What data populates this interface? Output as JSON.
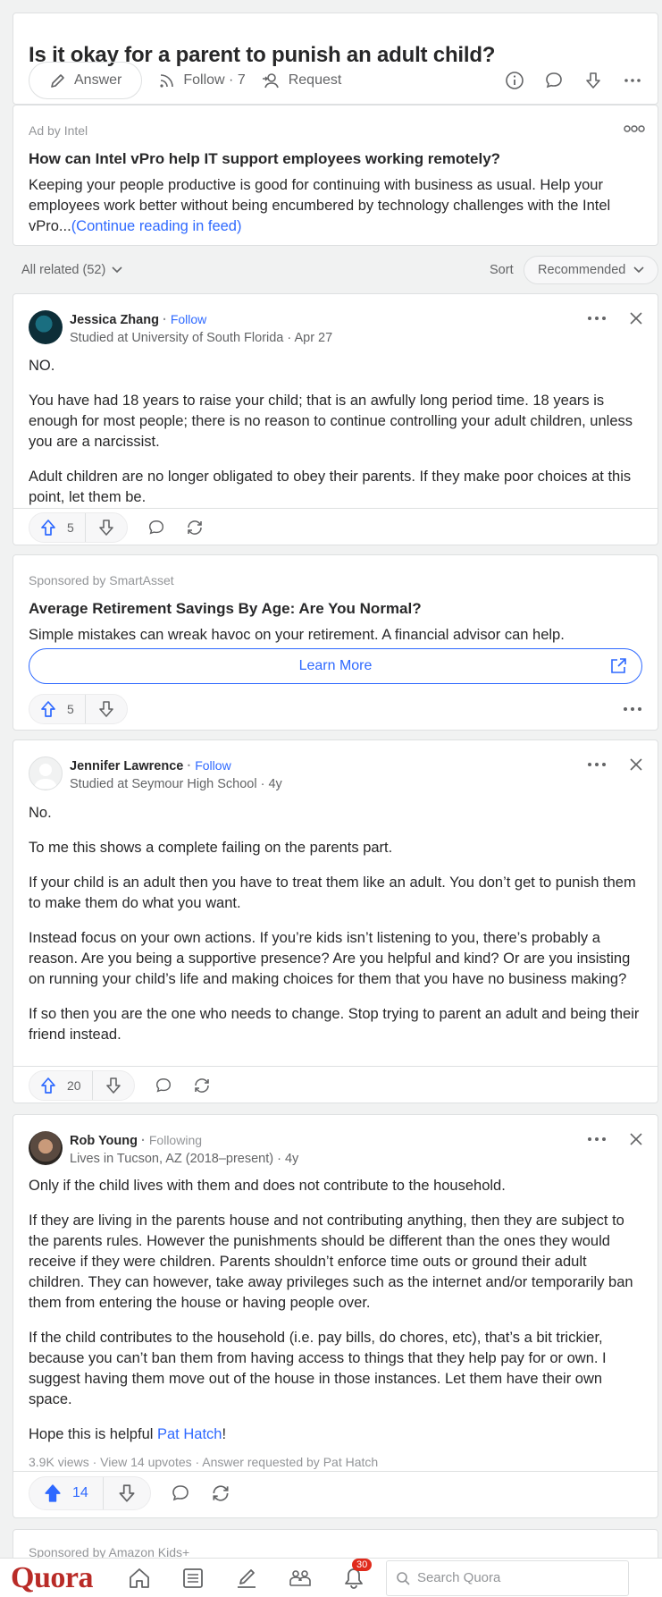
{
  "question": {
    "title": "Is it okay for a parent to punish an adult child?",
    "answer_label": "Answer",
    "follow_label": "Follow · 7",
    "request_label": "Request"
  },
  "ad_intel": {
    "label": "Ad by Intel",
    "headline": "How can Intel vPro help IT support employees working remotely?",
    "body": "Keeping your people productive is good for continuing with business as usual. Help your employees work better without being encumbered by technology challenges with the Intel vPro...",
    "continue_link": "(Continue reading in feed)"
  },
  "related": {
    "all_related": "All related (52)",
    "sort_label": "Sort",
    "sort_value": "Recommended"
  },
  "answers": [
    {
      "author": "Jessica Zhang",
      "follow": "Follow",
      "credential": "Studied at University of South Florida · Apr 27",
      "paragraphs": [
        "NO.",
        "You have had 18 years to raise your child; that is an awfully long period time. 18 years is enough for most people; there is no reason to continue controlling your adult children, unless you are a narcissist.",
        "Adult children are no longer obligated to obey their parents. If they make poor choices at this point, let them be."
      ],
      "upvotes": "5"
    },
    {
      "author": "Jennifer Lawrence",
      "follow": "Follow",
      "credential": "Studied at Seymour High School · 4y",
      "paragraphs": [
        "No.",
        "To me this shows a complete failing on the parents part.",
        "If your child is an adult then you have to treat them like an adult. You don’t get to punish them to make them do what you want.",
        "Instead focus on your own actions. If you’re kids isn’t listening to you, there’s probably a reason. Are you being a supportive presence? Are you helpful and kind? Or are you insisting on running your child’s life and making choices for them that you have no business making?",
        "If so then you are the one who needs to change. Stop trying to parent an adult and being their friend instead."
      ],
      "upvotes": "20"
    },
    {
      "author": "Rob Young",
      "follow": "Following",
      "credential": "Lives in Tucson, AZ (2018–present) · 4y",
      "paragraphs": [
        "Only if the child lives with them and does not contribute to the household.",
        "If they are living in the parents house and not contributing anything, then they are subject to the parents rules. However the punishments should be different than the ones they would receive if they were children. Parents shouldn’t enforce time outs or ground their adult children. They can however, take away privileges such as the internet and/or temporarily ban them from entering the house or having people over.",
        "If the child contributes to the household (i.e. pay bills, do chores, etc), that’s a bit trickier, because you can’t ban them from having access to things that they help pay for or own. I suggest having them move out of the house in those instances. Let them have their own space."
      ],
      "closing_prefix": "Hope this is helpful ",
      "closing_link": "Pat Hatch",
      "closing_suffix": "!",
      "meta": "3.9K views · View 14 upvotes · Answer requested by Pat Hatch",
      "upvotes": "14"
    }
  ],
  "ad_smartasset": {
    "label": "Sponsored by SmartAsset",
    "headline": "Average Retirement Savings By Age: Are You Normal?",
    "body": "Simple mistakes can wreak havoc on your retirement. A financial advisor can help.",
    "cta": "Learn More",
    "upvotes": "5"
  },
  "ad_amazon": {
    "label": "Sponsored by Amazon Kids+"
  },
  "bottom_nav": {
    "logo": "Quora",
    "notifications_count": "30",
    "search_placeholder": "Search Quora"
  },
  "colors": {
    "brand": "#b92b27",
    "accent": "#2e69ff",
    "badge": "#e02b1c"
  }
}
